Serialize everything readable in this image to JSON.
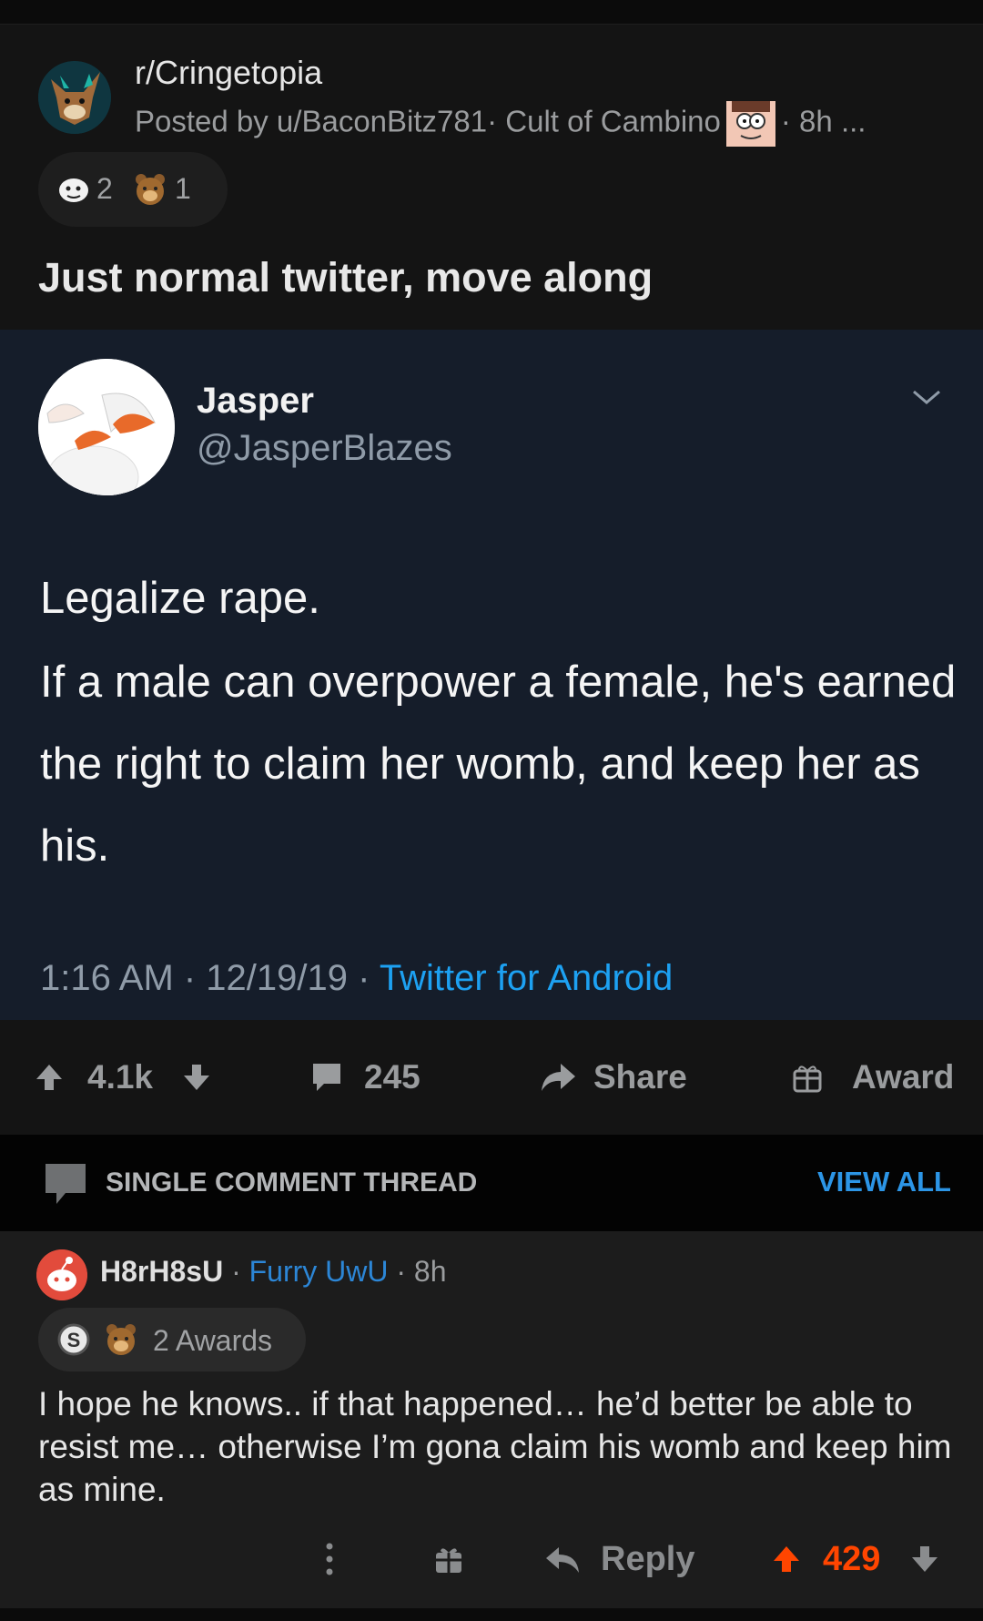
{
  "post": {
    "subreddit": "r/Cringetopia",
    "posted_by": "Posted by u/BaconBitz781",
    "user_flair": "Cult of Cambino",
    "age": "8h",
    "more": "...",
    "awards": [
      {
        "icon": "ghost-award-icon",
        "count": "2"
      },
      {
        "icon": "bear-award-icon",
        "count": "1"
      }
    ],
    "title": "Just normal twitter, move along"
  },
  "tweet": {
    "name": "Jasper",
    "handle": "@JasperBlazes",
    "line1": "Legalize rape.",
    "line2": "If a male can overpower a female, he's earned the right to claim her womb, and keep her as his.",
    "time": "1:16 AM · 12/19/19 ·",
    "source": "Twitter for Android"
  },
  "actions": {
    "votes": "4.1k",
    "comments": "245",
    "share": "Share",
    "award": "Award"
  },
  "thread": {
    "label": "SINGLE COMMENT THREAD",
    "view_all": "VIEW ALL"
  },
  "comment": {
    "user": "H8rH8sU",
    "flair": "Furry UwU",
    "age": "8h",
    "awards_text": "2 Awards",
    "body": "I hope he knows.. if that happened… he’d better be able to resist me… otherwise I’m gona claim his womb and keep him as mine.",
    "reply": "Reply",
    "votes": "429"
  },
  "colors": {
    "upvote_active": "#ff4500",
    "link_blue": "#1da1f2",
    "flair_blue": "#2c86d6",
    "tweet_bg": "#151d2a"
  }
}
